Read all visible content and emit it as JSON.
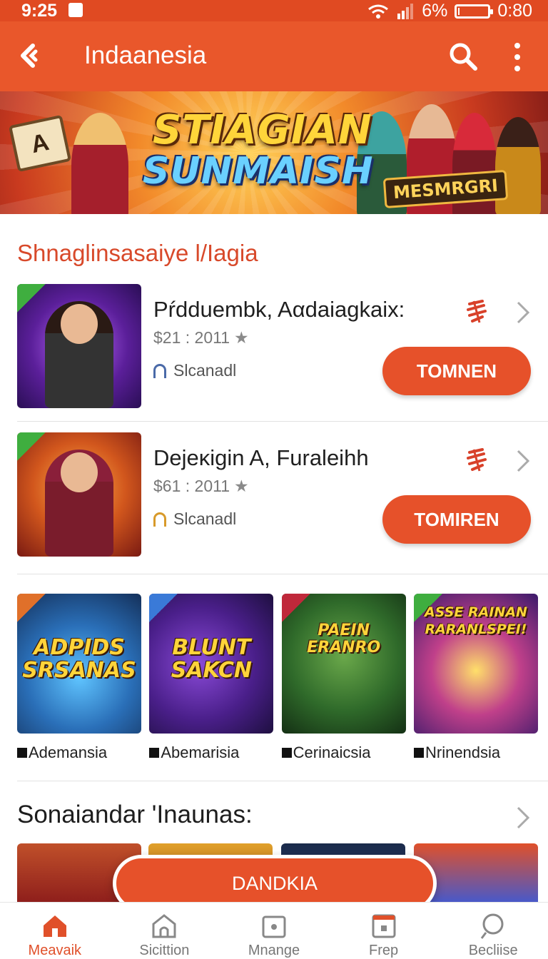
{
  "status_bar": {
    "time": "9:25",
    "battery_percent": "6%",
    "battery_level": 0.06,
    "clock_right": "0:80"
  },
  "header": {
    "title": "Indaanesia",
    "back_icon": "back-arrow-icon",
    "search_icon": "search-icon",
    "menu_icon": "more-vert-icon"
  },
  "banner": {
    "title_line1": "STIAGIAN",
    "title_line2": "SUNMAISH",
    "badge": "MESMRGRI",
    "tile_letter": "A"
  },
  "section1": {
    "title": "Shnaglinsasaiye l/Iagia",
    "items": [
      {
        "name": "Pŕdduembk, Aαdaiagkaix:",
        "price": "$21 : 2011",
        "developer": "Slcanadl",
        "button": "TOMNEN"
      },
      {
        "name": "Dejeĸigin A, Furaleihh",
        "price": "$61 : 2011",
        "developer": "Slcanadl",
        "button": "TOMIREN"
      }
    ]
  },
  "grid": [
    {
      "label": "Ademansia",
      "logo": "ADPIDS SRSANAS"
    },
    {
      "label": "Abemarisia",
      "logo": "BLUNT SAKCN"
    },
    {
      "label": "Cerinaicsia",
      "logo": "PAEIN ERANRO"
    },
    {
      "label": "Nrinendsia",
      "logo": "ASSE RAINAN RARANLSPEI!"
    }
  ],
  "section2": {
    "title": "Sonaiandar 'Inaunas:"
  },
  "download_button": "DANDKIA",
  "bottom_nav": [
    {
      "label": "Meavaik",
      "icon": "home-icon",
      "active": true
    },
    {
      "label": "Sicittion",
      "icon": "store-icon",
      "active": false
    },
    {
      "label": "Mnange",
      "icon": "manage-icon",
      "active": false
    },
    {
      "label": "Frep",
      "icon": "calendar-icon",
      "active": false
    },
    {
      "label": "Becliise",
      "icon": "search-icon",
      "active": false
    }
  ],
  "colors": {
    "accent": "#e9572b",
    "button": "#e6512a",
    "section_title": "#d8492a"
  }
}
